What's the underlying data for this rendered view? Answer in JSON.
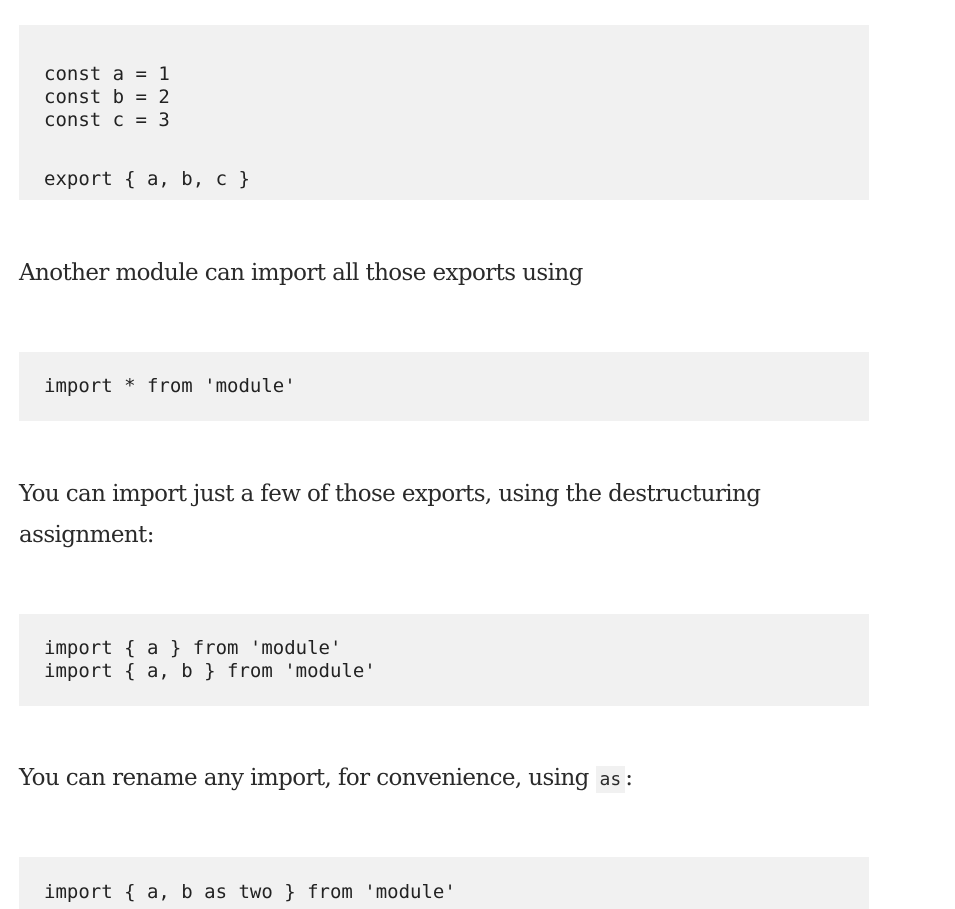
{
  "content": {
    "code_block_1": {
      "lines": [
        "const a = 1",
        "const b = 2",
        "const c = 3"
      ],
      "after_blank": [
        "export { a, b, c }"
      ]
    },
    "paragraph_1": "Another module can import all those exports using",
    "code_block_2": {
      "lines": [
        "import * from 'module'"
      ]
    },
    "paragraph_2": "You can import just a few of those exports, using the destructuring assignment:",
    "code_block_3": {
      "lines": [
        "import { a } from 'module'",
        "import { a, b } from 'module'"
      ]
    },
    "paragraph_3": {
      "text": "You can rename any import, for convenience, using ",
      "inline_code": "as",
      "suffix": ":"
    },
    "code_block_4": {
      "lines": [
        "import { a, b as two } from 'module'"
      ]
    }
  }
}
